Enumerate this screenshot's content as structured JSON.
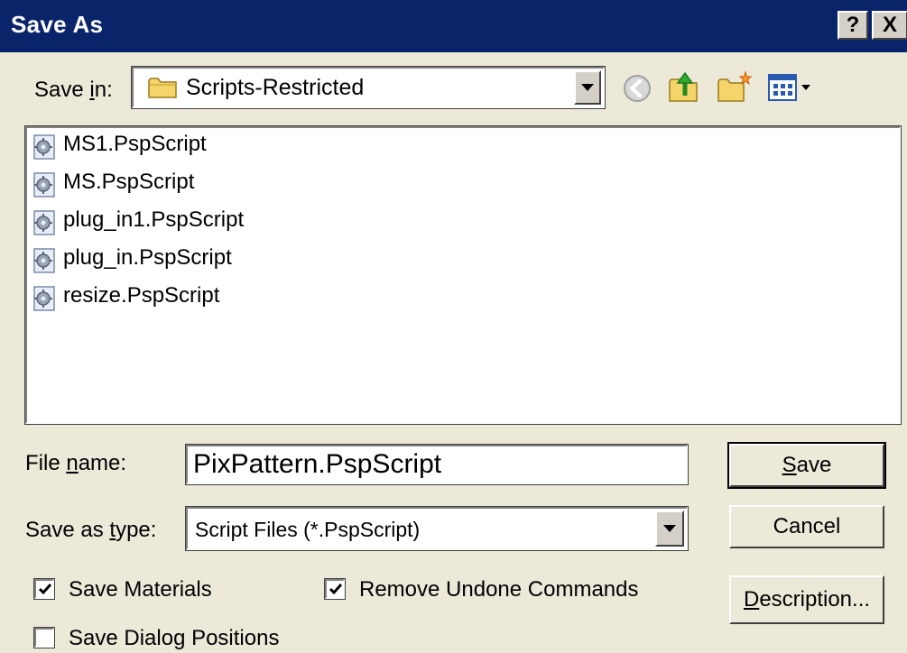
{
  "window": {
    "title": "Save As",
    "help_label": "?",
    "close_label": "X"
  },
  "save_in": {
    "label_prefix": "Save ",
    "label_accel": "i",
    "label_suffix": "n:",
    "value": "Scripts-Restricted"
  },
  "toolbar": {
    "icons": [
      "back-icon",
      "up-folder-icon",
      "new-folder-icon",
      "view-menu-icon"
    ]
  },
  "files": [
    {
      "name": "MS1.PspScript"
    },
    {
      "name": "MS.PspScript"
    },
    {
      "name": "plug_in1.PspScript"
    },
    {
      "name": "plug_in.PspScript"
    },
    {
      "name": "resize.PspScript"
    }
  ],
  "file_name": {
    "label_prefix": "File ",
    "label_accel": "n",
    "label_suffix": "ame:",
    "value": "PixPattern.PspScript"
  },
  "save_as_type": {
    "label_prefix": "Save as ",
    "label_accel": "t",
    "label_suffix": "ype:",
    "value": "Script Files (*.PspScript)"
  },
  "options": {
    "save_materials": {
      "label": "Save Materials",
      "checked": true
    },
    "remove_undone": {
      "label": "Remove Undone Commands",
      "checked": true
    },
    "save_dialog_positions": {
      "label": "Save Dialog Positions",
      "checked": false
    }
  },
  "buttons": {
    "save_accel": "S",
    "save_rest": "ave",
    "cancel": "Cancel",
    "description_accel": "D",
    "description_rest": "escription..."
  },
  "colors": {
    "titlebar": "#0a246a",
    "face": "#ece9d8",
    "folder": "#f5d56a"
  }
}
